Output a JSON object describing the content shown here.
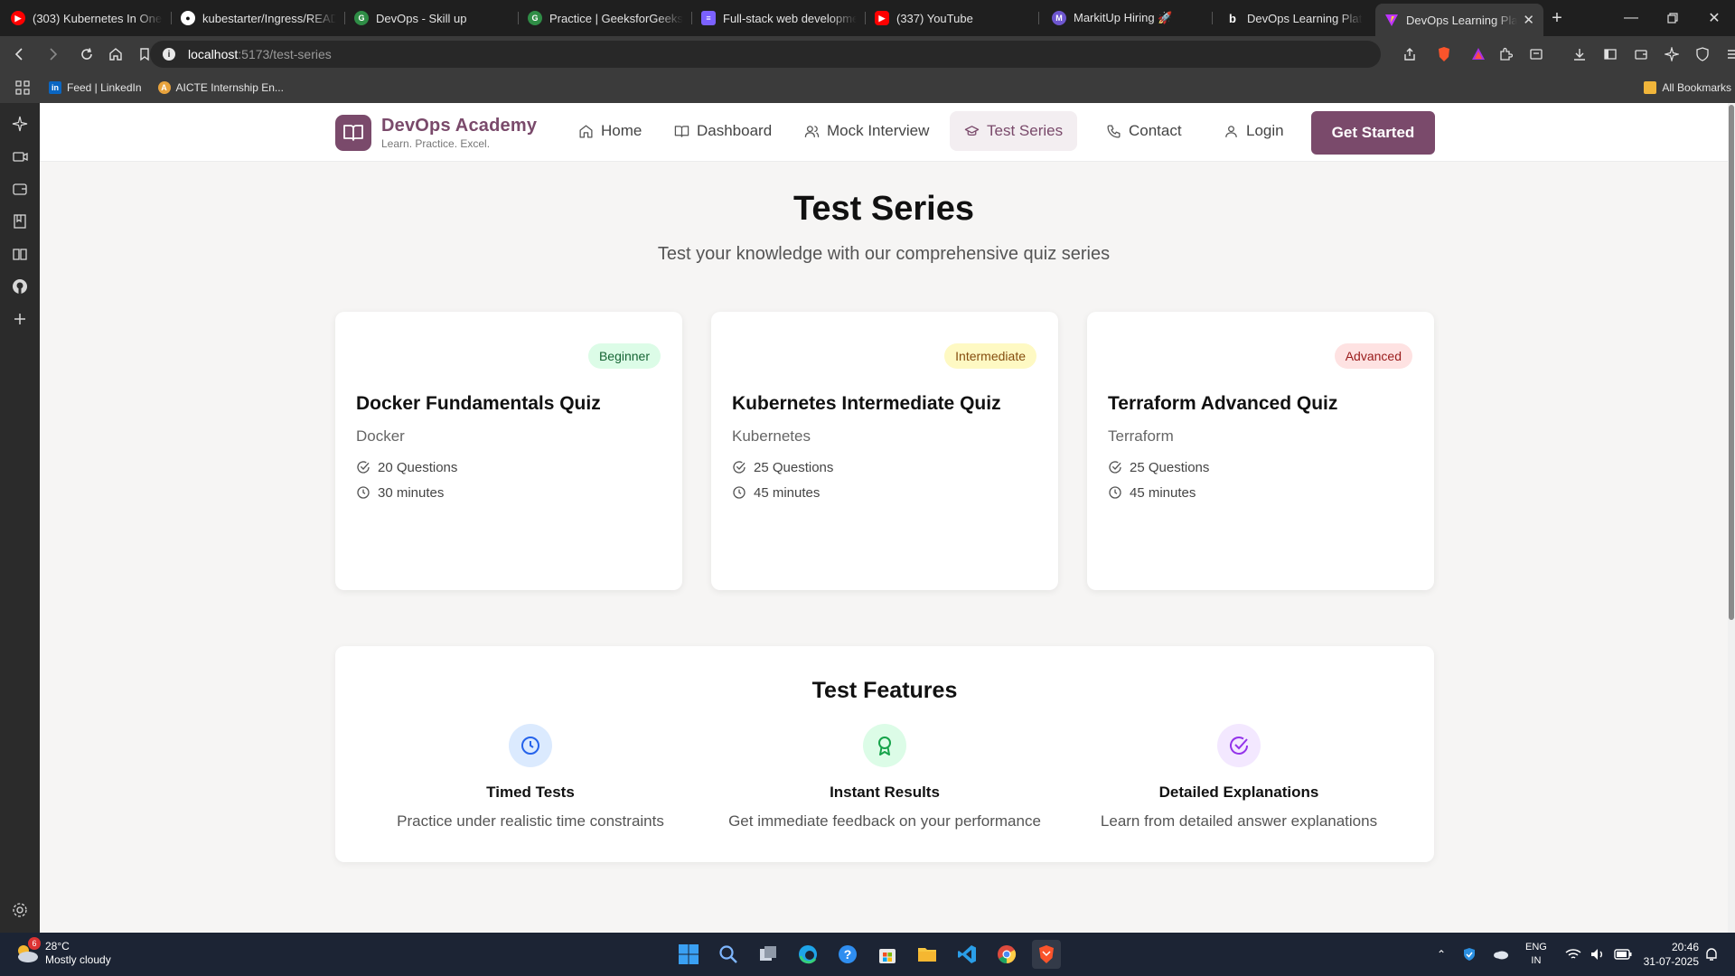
{
  "browser": {
    "tabs": [
      {
        "title": "(303) Kubernetes In One S",
        "icon": "youtube-icon",
        "color": "#ff0000"
      },
      {
        "title": "kubestarter/Ingress/READ",
        "icon": "github-icon",
        "color": "#ffffff"
      },
      {
        "title": "DevOps - Skill up",
        "icon": "site-icon",
        "color": "#2f8d46"
      },
      {
        "title": "Practice | GeeksforGeeks |",
        "icon": "gfg-icon",
        "color": "#2f8d46"
      },
      {
        "title": "Full-stack web developme",
        "icon": "doc-icon",
        "color": "#7b61ff"
      },
      {
        "title": "(337) YouTube",
        "icon": "youtube-icon",
        "color": "#ff0000"
      },
      {
        "title": "MarkitUp Hiring 🚀",
        "icon": "markitup-icon",
        "color": "#6e56cf"
      },
      {
        "title": "DevOps Learning Platform",
        "icon": "bolt-icon",
        "color": "#ffffff"
      },
      {
        "title": "DevOps Learning Platf",
        "icon": "vite-icon",
        "color": "#bd34fe",
        "active": true
      }
    ],
    "url_host": "localhost",
    "url_path": ":5173/test-series",
    "bookmarks": [
      {
        "label": "Feed | LinkedIn",
        "icon": "linkedin-icon",
        "color": "#0a66c2"
      },
      {
        "label": "AICTE Internship En...",
        "icon": "aicte-icon",
        "color": "#e8a33d"
      }
    ],
    "all_bookmarks": "All Bookmarks"
  },
  "nav": {
    "brand": "DevOps Academy",
    "tagline": "Learn. Practice. Excel.",
    "items": [
      {
        "label": "Home",
        "icon": "home-icon"
      },
      {
        "label": "Dashboard",
        "icon": "book-icon"
      },
      {
        "label": "Mock Interview",
        "icon": "users-icon"
      },
      {
        "label": "Test Series",
        "icon": "graduation-cap-icon",
        "active": true
      },
      {
        "label": "Contact",
        "icon": "phone-icon"
      }
    ],
    "login": "Login",
    "cta": "Get Started",
    "accent": "#7a4a6b"
  },
  "page": {
    "title": "Test Series",
    "subtitle": "Test your knowledge with our comprehensive quiz series"
  },
  "quizzes": [
    {
      "level": "Beginner",
      "title": "Docker Fundamentals Quiz",
      "category": "Docker",
      "questions": "20 Questions",
      "duration": "30 minutes",
      "badge_bg": "#dcfce7",
      "badge_fg": "#166534"
    },
    {
      "level": "Intermediate",
      "title": "Kubernetes Intermediate Quiz",
      "category": "Kubernetes",
      "questions": "25 Questions",
      "duration": "45 minutes",
      "badge_bg": "#fef9c3",
      "badge_fg": "#854d0e"
    },
    {
      "level": "Advanced",
      "title": "Terraform Advanced Quiz",
      "category": "Terraform",
      "questions": "25 Questions",
      "duration": "45 minutes",
      "badge_bg": "#fee2e2",
      "badge_fg": "#991b1b"
    }
  ],
  "features": {
    "title": "Test Features",
    "items": [
      {
        "heading": "Timed Tests",
        "desc": "Practice under realistic time constraints",
        "icon": "clock-icon",
        "bg": "#dbeafe",
        "fg": "#2563eb"
      },
      {
        "heading": "Instant Results",
        "desc": "Get immediate feedback on your performance",
        "icon": "award-icon",
        "bg": "#dcfce7",
        "fg": "#16a34a"
      },
      {
        "heading": "Detailed Explanations",
        "desc": "Learn from detailed answer explanations",
        "icon": "check-circle-icon",
        "bg": "#f3e8ff",
        "fg": "#9333ea"
      }
    ]
  },
  "taskbar": {
    "weather_temp": "28°C",
    "weather_desc": "Mostly cloudy",
    "weather_badge": "6",
    "lang_1": "ENG",
    "lang_2": "IN",
    "time": "20:46",
    "date": "31-07-2025"
  }
}
